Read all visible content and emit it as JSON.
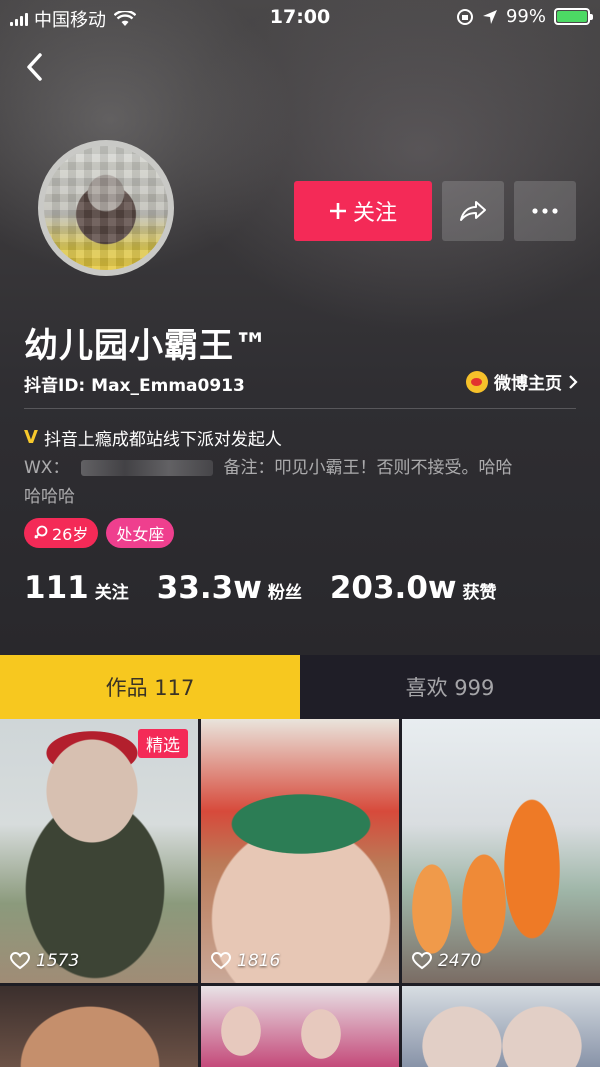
{
  "status_bar": {
    "carrier": "中国移动",
    "time": "17:00",
    "battery": "99%",
    "colors": {
      "battery_fill": "#4cd964"
    }
  },
  "profile": {
    "nickname": "幼儿园小霸王™",
    "douyin_id": "抖音ID: Max_Emma0913",
    "weibo_label": "微博主页",
    "verification": "抖音上瘾成都站线下派对发起人",
    "bio_wx_label": "WX：",
    "bio_line1_rest": "备注：叩见小霸王！否则不接受。哈哈",
    "bio_line2": "哈哈哈",
    "tags": {
      "age": "26岁",
      "zodiac": "处女座"
    }
  },
  "actions": {
    "follow_label": "关注",
    "icons": [
      "back-chevron-icon",
      "share-arrow-icon",
      "more-dots-icon",
      "weibo-icon",
      "female-icon",
      "heart-icon"
    ]
  },
  "stats": {
    "following_count": "111",
    "following_label": "关注",
    "followers_count": "33.3w",
    "followers_label": "粉丝",
    "likes_count": "203.0w",
    "likes_label": "获赞"
  },
  "tabs": {
    "works": "作品 117",
    "likes": "喜欢 999",
    "active": "works"
  },
  "videos": [
    {
      "likes": "1573",
      "featured": "精选"
    },
    {
      "likes": "1816"
    },
    {
      "likes": "2470"
    }
  ],
  "colors": {
    "accent_red": "#f42a57",
    "tab_active": "#f7c81f",
    "zodiac_tag": "#ef3f8e"
  }
}
